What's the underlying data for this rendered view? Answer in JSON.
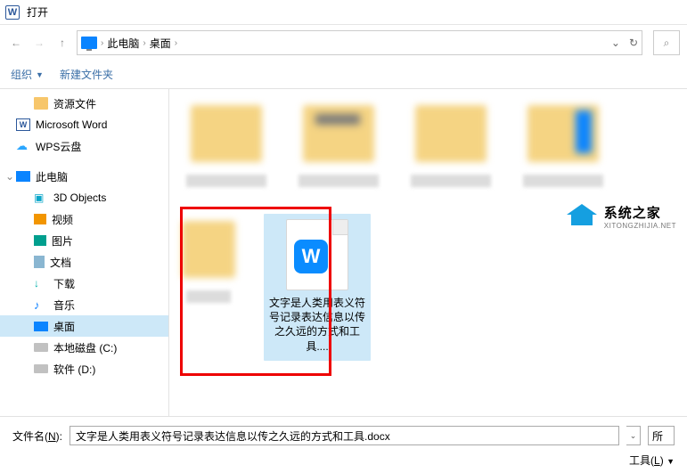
{
  "titlebar": {
    "app_letter": "W",
    "title": "打开"
  },
  "breadcrumb": {
    "root": "此电脑",
    "leaf": "桌面"
  },
  "toolbar": {
    "organize": "组织",
    "new_folder": "新建文件夹"
  },
  "sidebar": {
    "resources": "资源文件",
    "word": "Microsoft Word",
    "wps": "WPS云盘",
    "this_pc": "此电脑",
    "children": {
      "objects3d": "3D Objects",
      "video": "视频",
      "pictures": "图片",
      "documents": "文档",
      "downloads": "下载",
      "music": "音乐",
      "desktop": "桌面",
      "drive_c": "本地磁盘 (C:)",
      "drive_d": "软件 (D:)"
    }
  },
  "content": {
    "doc_badge": "W",
    "doc_label": "文字是人类用表义符号记录表达信息以传之久远的方式和工具...."
  },
  "watermark": {
    "title": "系统之家",
    "sub": "XITONGZHIJIA.NET"
  },
  "footer": {
    "filename_label_pre": "文件名(",
    "filename_accel": "N",
    "filename_label_post": "):",
    "filename_value": "文字是人类用表义符号记录表达信息以传之久远的方式和工具.docx",
    "filter_label": "所",
    "tools_pre": "工具(",
    "tools_accel": "L",
    "tools_post": ")"
  }
}
